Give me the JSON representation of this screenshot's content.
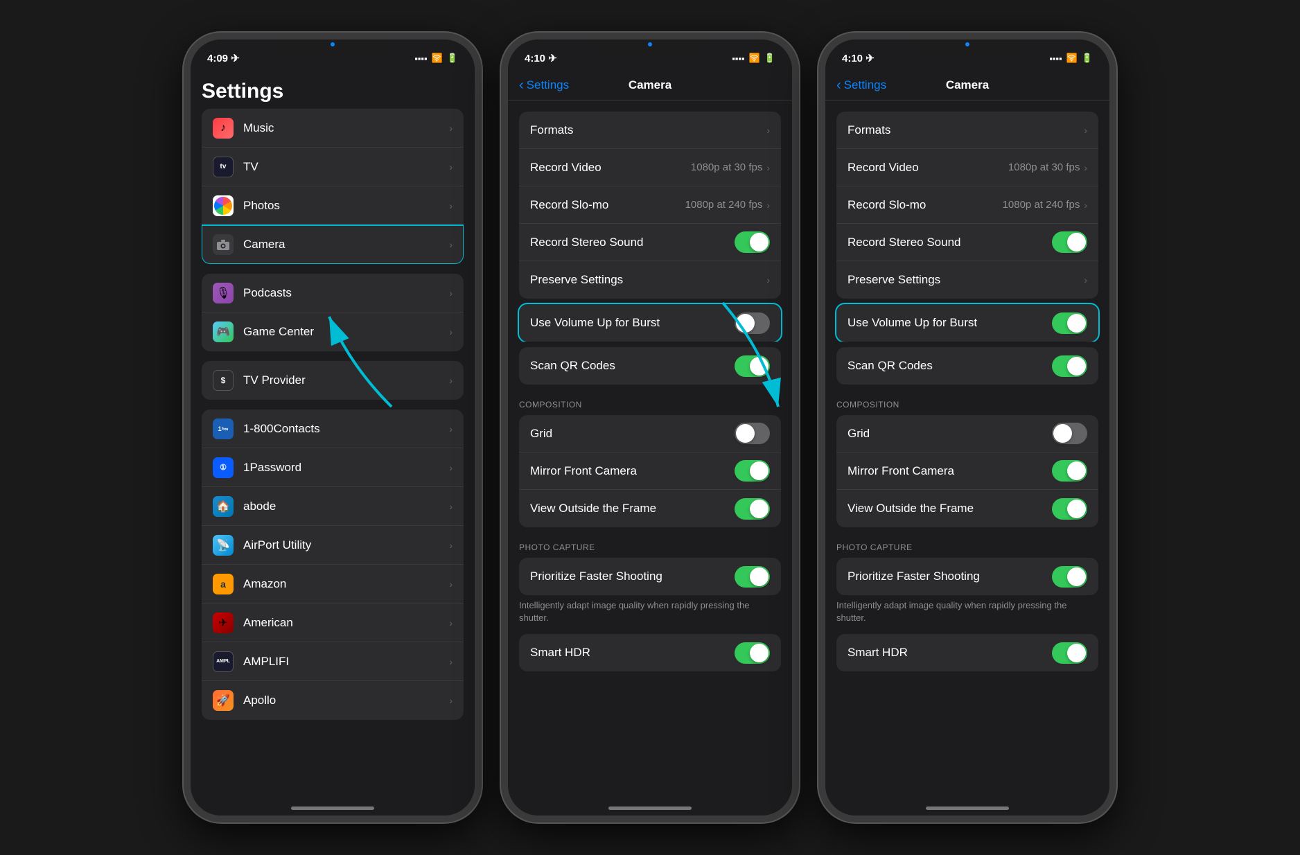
{
  "phones": [
    {
      "id": "phone1",
      "statusBar": {
        "time": "4:09",
        "hasLocation": true
      },
      "screen": "settings_list",
      "navTitle": "Settings",
      "settingsGroups": [
        {
          "items": [
            {
              "id": "music",
              "icon": "music",
              "label": "Music",
              "hasChevron": true
            },
            {
              "id": "tv",
              "icon": "tv",
              "label": "TV",
              "hasChevron": true
            },
            {
              "id": "photos",
              "icon": "photos",
              "label": "Photos",
              "hasChevron": true
            },
            {
              "id": "camera",
              "icon": "camera",
              "label": "Camera",
              "hasChevron": true,
              "highlighted": true
            }
          ]
        },
        {
          "items": [
            {
              "id": "podcasts",
              "icon": "podcasts",
              "label": "Podcasts",
              "hasChevron": true
            },
            {
              "id": "gamecenter",
              "icon": "gamecenter",
              "label": "Game Center",
              "hasChevron": true
            }
          ]
        },
        {
          "items": [
            {
              "id": "tvprovider",
              "icon": "tvprovider",
              "label": "TV Provider",
              "hasChevron": true
            }
          ]
        },
        {
          "items": [
            {
              "id": "contacts1800",
              "icon": "contacts1800",
              "label": "1-800Contacts",
              "hasChevron": true
            },
            {
              "id": "onepassword",
              "icon": "onepassword",
              "label": "1Password",
              "hasChevron": true
            },
            {
              "id": "abode",
              "icon": "abode",
              "label": "abode",
              "hasChevron": true
            },
            {
              "id": "airport",
              "icon": "airport",
              "label": "AirPort Utility",
              "hasChevron": true
            },
            {
              "id": "amazon",
              "icon": "amazon",
              "label": "Amazon",
              "hasChevron": true
            },
            {
              "id": "american",
              "icon": "american",
              "label": "American",
              "hasChevron": true
            },
            {
              "id": "amplifi",
              "icon": "amplifi",
              "label": "AMPLIFI",
              "hasChevron": true
            },
            {
              "id": "apollo",
              "icon": "apollo",
              "label": "Apollo",
              "hasChevron": true
            }
          ]
        }
      ]
    },
    {
      "id": "phone2",
      "statusBar": {
        "time": "4:10",
        "hasLocation": true
      },
      "screen": "camera_settings",
      "navBack": "Settings",
      "navTitle": "Camera",
      "burstToggle": "off",
      "items": [
        {
          "id": "formats",
          "label": "Formats",
          "type": "chevron"
        },
        {
          "id": "recordvideo",
          "label": "Record Video",
          "value": "1080p at 30 fps",
          "type": "value"
        },
        {
          "id": "recordslomo",
          "label": "Record Slo-mo",
          "value": "1080p at 240 fps",
          "type": "value"
        },
        {
          "id": "recordstereo",
          "label": "Record Stereo Sound",
          "type": "toggle",
          "state": "on"
        },
        {
          "id": "preservesettings",
          "label": "Preserve Settings",
          "type": "chevron"
        },
        {
          "id": "usevolumeup",
          "label": "Use Volume Up for Burst",
          "type": "toggle",
          "state": "off",
          "highlighted": true
        },
        {
          "id": "scanqr",
          "label": "Scan QR Codes",
          "type": "toggle",
          "state": "on"
        }
      ],
      "composition": {
        "header": "COMPOSITION",
        "items": [
          {
            "id": "grid",
            "label": "Grid",
            "type": "toggle",
            "state": "off"
          },
          {
            "id": "mirrorfrontcamera",
            "label": "Mirror Front Camera",
            "type": "toggle",
            "state": "on"
          },
          {
            "id": "viewoutside",
            "label": "View Outside the Frame",
            "type": "toggle",
            "state": "on"
          }
        ]
      },
      "photocapture": {
        "header": "PHOTO CAPTURE",
        "items": [
          {
            "id": "prioritizefaster",
            "label": "Prioritize Faster Shooting",
            "type": "toggle",
            "state": "on"
          }
        ],
        "note": "Intelligently adapt image quality when rapidly pressing the shutter.",
        "smartHDR": {
          "label": "Smart HDR",
          "state": "on"
        }
      }
    },
    {
      "id": "phone3",
      "statusBar": {
        "time": "4:10",
        "hasLocation": true
      },
      "screen": "camera_settings",
      "navBack": "Settings",
      "navTitle": "Camera",
      "burstToggle": "on",
      "items": [
        {
          "id": "formats",
          "label": "Formats",
          "type": "chevron"
        },
        {
          "id": "recordvideo",
          "label": "Record Video",
          "value": "1080p at 30 fps",
          "type": "value"
        },
        {
          "id": "recordslomo",
          "label": "Record Slo-mo",
          "value": "1080p at 240 fps",
          "type": "value"
        },
        {
          "id": "recordstereo",
          "label": "Record Stereo Sound",
          "type": "toggle",
          "state": "on"
        },
        {
          "id": "preservesettings",
          "label": "Preserve Settings",
          "type": "chevron"
        },
        {
          "id": "usevolumeup",
          "label": "Use Volume Up for Burst",
          "type": "toggle",
          "state": "on",
          "highlighted": true
        },
        {
          "id": "scanqr",
          "label": "Scan QR Codes",
          "type": "toggle",
          "state": "on"
        }
      ],
      "composition": {
        "header": "COMPOSITION",
        "items": [
          {
            "id": "grid",
            "label": "Grid",
            "type": "toggle",
            "state": "off"
          },
          {
            "id": "mirrorfrontcamera",
            "label": "Mirror Front Camera",
            "type": "toggle",
            "state": "on"
          },
          {
            "id": "viewoutside",
            "label": "View Outside the Frame",
            "type": "toggle",
            "state": "on"
          }
        ]
      },
      "photocapture": {
        "header": "PHOTO CAPTURE",
        "items": [
          {
            "id": "prioritizefaster",
            "label": "Prioritize Faster Shooting",
            "type": "toggle",
            "state": "on"
          }
        ],
        "note": "Intelligently adapt image quality when rapidly pressing the shutter.",
        "smartHDR": {
          "label": "Smart HDR",
          "state": "on"
        }
      }
    }
  ],
  "colors": {
    "accent": "#00bcd4",
    "toggleOn": "#34c759",
    "toggleOff": "#636366",
    "background": "#1c1c1e",
    "cell": "#2c2c2e",
    "separator": "#3a3a3a",
    "primaryText": "#ffffff",
    "secondaryText": "#8e8e93",
    "blueLink": "#0a84ff"
  }
}
